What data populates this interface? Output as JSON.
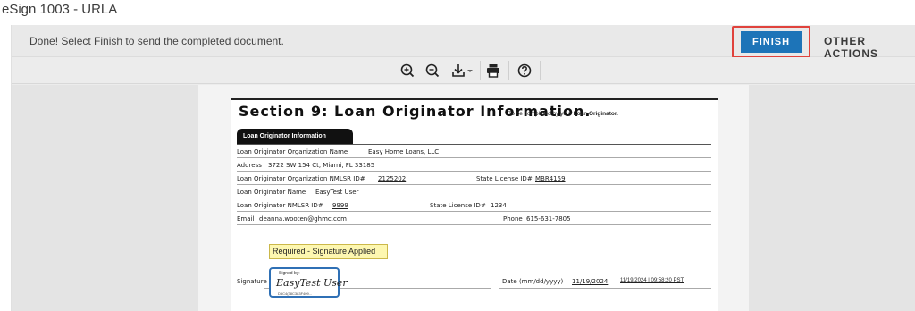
{
  "window": {
    "title": "eSign 1003 - URLA"
  },
  "action_bar": {
    "message": "Done! Select Finish to send the completed document.",
    "finish_label": "FINISH",
    "other_actions_label": "OTHER ACTIONS",
    "accent_color": "#1d74b8",
    "highlight_color": "#e0423c"
  },
  "toolbar": {
    "icons": [
      "zoom-in-icon",
      "zoom-out-icon",
      "download-icon",
      "print-icon",
      "help-icon"
    ]
  },
  "document": {
    "section_title": "Section 9: Loan Originator Information",
    "section_title_dot": ".",
    "section_note_prefix": "To be completed by your",
    "section_note_bold": "Loan Originator.",
    "tab_label": "Loan Originator Information",
    "rows": {
      "org_name_label": "Loan Originator Organization Name",
      "org_name_value": "Easy Home Loans, LLC",
      "address_label": "Address",
      "address_value": "3722 SW 154 Ct, Miami, FL 33185",
      "org_nmlsr_label": "Loan Originator Organization NMLSR ID#",
      "org_nmlsr_value": "2125202",
      "org_state_license_label": "State License ID#",
      "org_state_license_value": "MBR4159",
      "lo_name_label": "Loan Originator Name",
      "lo_name_value": "EasyTest User",
      "lo_nmlsr_label": "Loan Originator NMLSR ID#",
      "lo_nmlsr_value": "9999",
      "lo_state_license_label": "State License ID#",
      "lo_state_license_value": "1234",
      "email_label": "Email",
      "email_value": "deanna.wooten@ghmc.com",
      "phone_label": "Phone",
      "phone_value": "615-631-7805"
    },
    "required_badge": "Required - Signature Applied",
    "signature": {
      "signed_by": "Signed by:",
      "name": "EasyTest User",
      "id_text": "D5C4(38C383F409...",
      "label": "Signature",
      "date_label": "Date (mm/dd/yyyy)",
      "date_value": "11/19/2024",
      "timestamp": "11/19/2024 | 09:58:20 PST"
    }
  }
}
